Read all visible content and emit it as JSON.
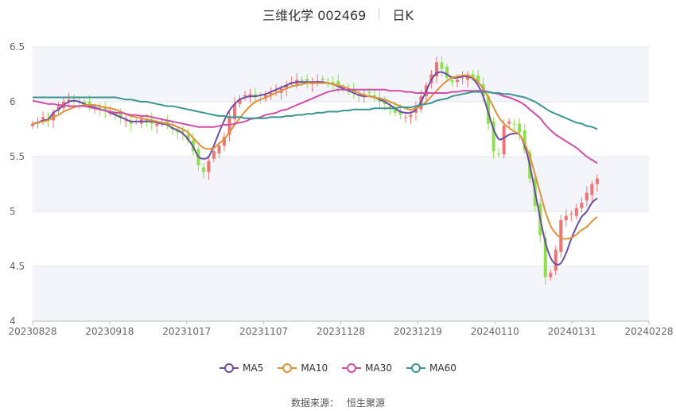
{
  "title": {
    "name": "三维化学 002469",
    "period": "日K"
  },
  "source": {
    "label": "数据来源：",
    "provider": "恒生聚源"
  },
  "colors": {
    "up": "#f07474",
    "down": "#8ee04d",
    "MA5": "#6b4ea6",
    "MA10": "#e0913a",
    "MA30": "#d24da8",
    "MA60": "#3d9494",
    "band": "#f3f5fa",
    "grid": "#e6e6e6"
  },
  "chart_data": {
    "type": "candlestick",
    "x_ticks": [
      "20230828",
      "20230918",
      "20231017",
      "20231107",
      "20231128",
      "20231219",
      "20240110",
      "20240131",
      "20240228"
    ],
    "y_ticks": [
      "4",
      "4.5",
      "5",
      "5.5",
      "6",
      "6.5"
    ],
    "ylim": [
      4,
      6.5
    ],
    "n_sessions": 120,
    "legend": [
      "MA5",
      "MA10",
      "MA30",
      "MA60"
    ],
    "close": [
      5.8,
      5.82,
      5.86,
      5.83,
      5.9,
      5.96,
      6.0,
      6.02,
      6.03,
      6.0,
      5.98,
      5.96,
      5.95,
      5.93,
      5.92,
      5.9,
      5.88,
      5.85,
      5.83,
      5.8,
      5.82,
      5.84,
      5.82,
      5.8,
      5.8,
      5.81,
      5.79,
      5.75,
      5.72,
      5.72,
      5.65,
      5.55,
      5.42,
      5.36,
      5.46,
      5.55,
      5.6,
      5.68,
      5.86,
      5.98,
      6.03,
      6.06,
      6.07,
      6.04,
      6.05,
      6.06,
      6.08,
      6.1,
      6.12,
      6.15,
      6.18,
      6.2,
      6.19,
      6.18,
      6.17,
      6.19,
      6.2,
      6.18,
      6.17,
      6.15,
      6.12,
      6.1,
      6.08,
      6.06,
      6.07,
      6.08,
      6.04,
      6.0,
      5.98,
      5.95,
      5.9,
      5.88,
      5.86,
      5.88,
      5.95,
      6.05,
      6.15,
      6.25,
      6.36,
      6.3,
      6.22,
      6.18,
      6.2,
      6.22,
      6.25,
      6.22,
      6.18,
      6.05,
      5.8,
      5.55,
      5.52,
      5.78,
      5.82,
      5.8,
      5.72,
      5.56,
      5.3,
      5.05,
      4.78,
      4.4,
      4.44,
      4.65,
      4.92,
      4.96,
      4.98,
      5.03,
      5.08,
      5.17,
      5.25,
      5.3
    ],
    "series": [
      {
        "name": "MA5",
        "values": [
          5.8,
          5.81,
          5.83,
          5.84,
          5.9,
          5.93,
          5.97,
          6.0,
          6.01,
          6.0,
          5.98,
          5.96,
          5.95,
          5.93,
          5.92,
          5.9,
          5.88,
          5.86,
          5.84,
          5.82,
          5.82,
          5.82,
          5.82,
          5.82,
          5.81,
          5.8,
          5.79,
          5.76,
          5.74,
          5.71,
          5.66,
          5.59,
          5.5,
          5.48,
          5.5,
          5.6,
          5.72,
          5.83,
          5.92,
          5.98,
          6.02,
          6.04,
          6.05,
          6.05,
          6.06,
          6.07,
          6.09,
          6.11,
          6.13,
          6.15,
          6.17,
          6.18,
          6.18,
          6.18,
          6.18,
          6.18,
          6.18,
          6.17,
          6.16,
          6.14,
          6.12,
          6.1,
          6.08,
          6.06,
          6.05,
          6.05,
          6.04,
          6.02,
          6.0,
          5.97,
          5.94,
          5.91,
          5.9,
          5.9,
          5.93,
          6.0,
          6.1,
          6.2,
          6.26,
          6.27,
          6.25,
          6.22,
          6.22,
          6.23,
          6.23,
          6.21,
          6.15,
          6.05,
          5.9,
          5.75,
          5.66,
          5.67,
          5.7,
          5.71,
          5.7,
          5.6,
          5.42,
          5.18,
          4.94,
          4.72,
          4.58,
          4.52,
          4.53,
          4.62,
          4.75,
          4.86,
          4.95,
          5.0,
          5.08,
          5.12
        ]
      },
      {
        "name": "MA10",
        "values": [
          5.8,
          5.81,
          5.82,
          5.83,
          5.86,
          5.88,
          5.91,
          5.93,
          5.95,
          5.96,
          5.97,
          5.97,
          5.97,
          5.96,
          5.95,
          5.94,
          5.93,
          5.91,
          5.89,
          5.87,
          5.86,
          5.85,
          5.84,
          5.83,
          5.82,
          5.81,
          5.8,
          5.79,
          5.77,
          5.75,
          5.72,
          5.67,
          5.62,
          5.58,
          5.57,
          5.58,
          5.62,
          5.66,
          5.72,
          5.79,
          5.85,
          5.91,
          5.96,
          6.0,
          6.02,
          6.04,
          6.06,
          6.08,
          6.1,
          6.12,
          6.14,
          6.15,
          6.16,
          6.17,
          6.17,
          6.17,
          6.17,
          6.17,
          6.16,
          6.15,
          6.14,
          6.12,
          6.1,
          6.08,
          6.06,
          6.05,
          6.04,
          6.03,
          6.02,
          6.0,
          5.98,
          5.96,
          5.94,
          5.93,
          5.94,
          5.96,
          6.0,
          6.05,
          6.1,
          6.15,
          6.19,
          6.22,
          6.23,
          6.24,
          6.24,
          6.22,
          6.18,
          6.12,
          6.04,
          5.95,
          5.86,
          5.8,
          5.76,
          5.73,
          5.7,
          5.62,
          5.5,
          5.34,
          5.17,
          5.0,
          4.87,
          4.8,
          4.76,
          4.75,
          4.76,
          4.79,
          4.83,
          4.86,
          4.91,
          4.95
        ]
      },
      {
        "name": "MA30",
        "values": [
          6.01,
          6.0,
          5.99,
          5.98,
          5.98,
          5.97,
          5.97,
          5.96,
          5.96,
          5.96,
          5.96,
          5.95,
          5.94,
          5.93,
          5.92,
          5.91,
          5.9,
          5.9,
          5.89,
          5.88,
          5.88,
          5.87,
          5.87,
          5.86,
          5.85,
          5.84,
          5.83,
          5.82,
          5.81,
          5.8,
          5.79,
          5.78,
          5.77,
          5.77,
          5.77,
          5.77,
          5.78,
          5.79,
          5.79,
          5.8,
          5.81,
          5.82,
          5.84,
          5.85,
          5.86,
          5.88,
          5.89,
          5.9,
          5.92,
          5.93,
          5.95,
          5.97,
          5.99,
          6.01,
          6.03,
          6.05,
          6.07,
          6.09,
          6.1,
          6.11,
          6.11,
          6.11,
          6.11,
          6.11,
          6.11,
          6.11,
          6.11,
          6.11,
          6.11,
          6.1,
          6.1,
          6.1,
          6.09,
          6.09,
          6.08,
          6.08,
          6.08,
          6.08,
          6.08,
          6.08,
          6.08,
          6.09,
          6.09,
          6.1,
          6.1,
          6.1,
          6.1,
          6.1,
          6.09,
          6.08,
          6.07,
          6.05,
          6.04,
          6.02,
          6.0,
          5.97,
          5.93,
          5.89,
          5.85,
          5.79,
          5.74,
          5.7,
          5.67,
          5.64,
          5.61,
          5.58,
          5.54,
          5.5,
          5.47,
          5.44
        ]
      },
      {
        "name": "MA60",
        "values": [
          6.04,
          6.04,
          6.04,
          6.04,
          6.04,
          6.04,
          6.04,
          6.04,
          6.04,
          6.04,
          6.04,
          6.04,
          6.04,
          6.04,
          6.04,
          6.04,
          6.04,
          6.03,
          6.02,
          6.02,
          6.01,
          6.0,
          6.0,
          5.99,
          5.98,
          5.97,
          5.96,
          5.96,
          5.95,
          5.94,
          5.93,
          5.92,
          5.91,
          5.9,
          5.89,
          5.88,
          5.87,
          5.87,
          5.86,
          5.86,
          5.86,
          5.85,
          5.85,
          5.85,
          5.85,
          5.85,
          5.86,
          5.86,
          5.86,
          5.87,
          5.87,
          5.88,
          5.88,
          5.89,
          5.89,
          5.9,
          5.9,
          5.91,
          5.91,
          5.91,
          5.92,
          5.92,
          5.93,
          5.93,
          5.93,
          5.93,
          5.94,
          5.94,
          5.94,
          5.94,
          5.94,
          5.95,
          5.95,
          5.95,
          5.96,
          5.97,
          5.98,
          5.99,
          6.01,
          6.02,
          6.03,
          6.05,
          6.06,
          6.07,
          6.08,
          6.09,
          6.09,
          6.09,
          6.09,
          6.08,
          6.08,
          6.07,
          6.07,
          6.06,
          6.05,
          6.04,
          6.02,
          6.0,
          5.97,
          5.94,
          5.91,
          5.89,
          5.87,
          5.85,
          5.83,
          5.81,
          5.8,
          5.78,
          5.77,
          5.75
        ]
      }
    ]
  }
}
